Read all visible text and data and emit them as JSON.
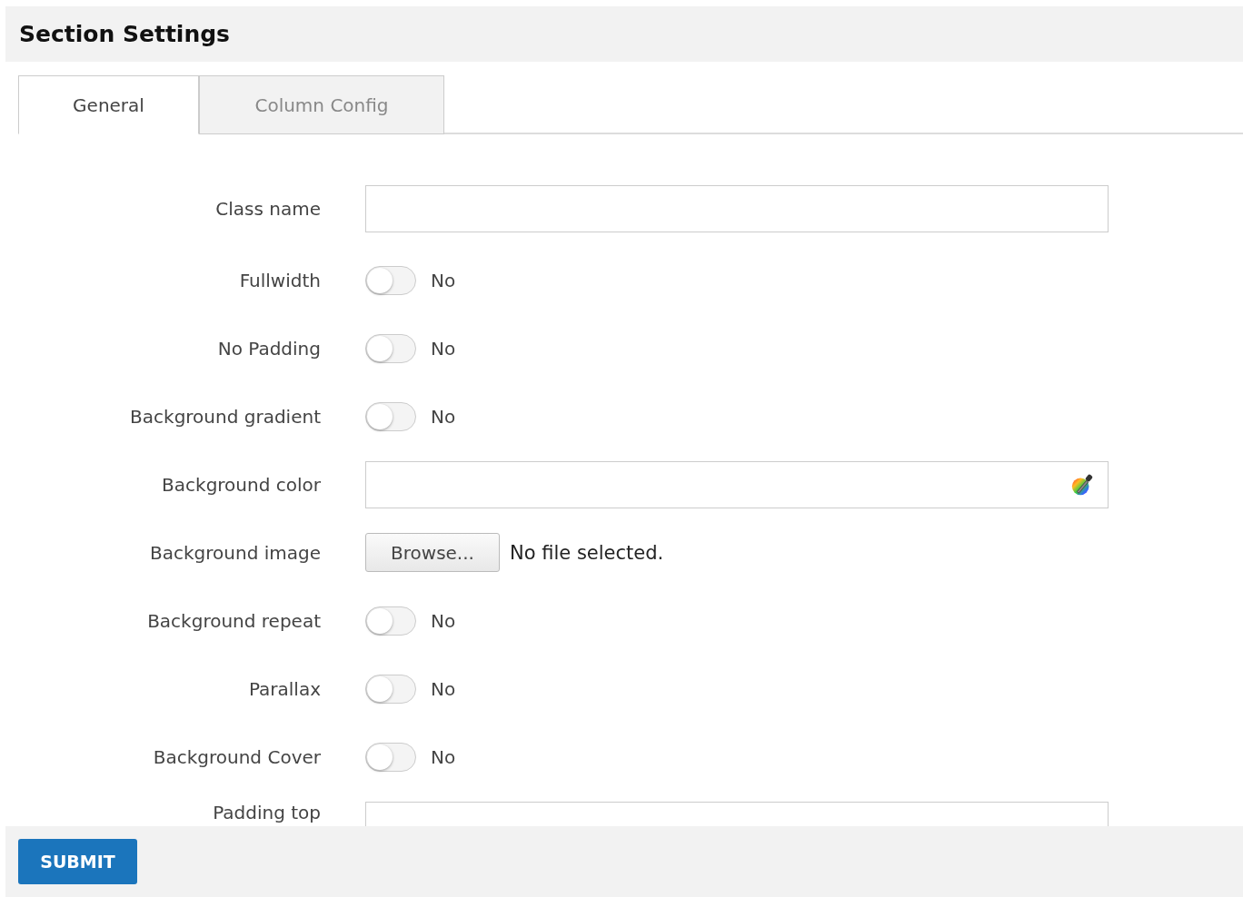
{
  "title": "Section Settings",
  "tabs": [
    {
      "label": "General",
      "selected": true
    },
    {
      "label": "Column Config",
      "selected": false
    }
  ],
  "fields": [
    {
      "kind": "text",
      "label": "Class name"
    },
    {
      "kind": "toggle",
      "label": "Fullwidth",
      "on": false,
      "state": "No"
    },
    {
      "kind": "toggle",
      "label": "No Padding",
      "on": false,
      "state": "No"
    },
    {
      "kind": "toggle",
      "label": "Background gradient",
      "on": false,
      "state": "No"
    },
    {
      "kind": "color",
      "label": "Background color"
    },
    {
      "kind": "file",
      "label": "Background image",
      "button": "Browse...",
      "status": "No file selected."
    },
    {
      "kind": "toggle",
      "label": "Background repeat",
      "on": false,
      "state": "No"
    },
    {
      "kind": "toggle",
      "label": "Parallax",
      "on": false,
      "state": "No"
    },
    {
      "kind": "toggle",
      "label": "Background Cover",
      "on": false,
      "state": "No"
    },
    {
      "kind": "text",
      "label": "Padding top"
    }
  ],
  "submit": "SUBMIT"
}
